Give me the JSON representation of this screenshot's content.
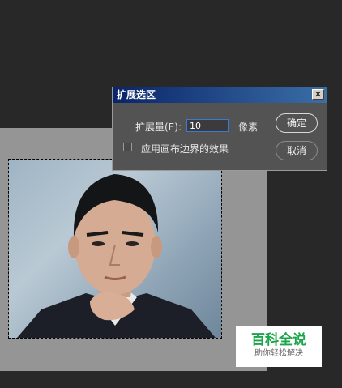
{
  "dialog": {
    "title": "扩展选区",
    "close_glyph": "✕",
    "expand_label": "扩展量(E):",
    "expand_value": "10",
    "unit": "像素",
    "apply_canvas_label": "应用画布边界的效果",
    "apply_canvas_checked": false,
    "ok_label": "确定",
    "cancel_label": "取消"
  },
  "watermark": {
    "main": "百科全说",
    "sub": "助你轻松解决"
  }
}
